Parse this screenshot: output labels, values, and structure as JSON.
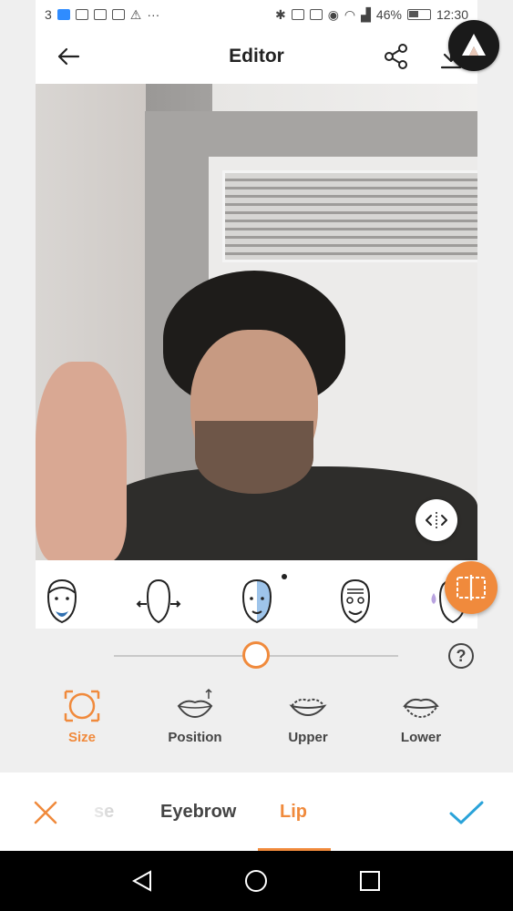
{
  "status_bar": {
    "left_text": "3",
    "dots": "···",
    "battery_percent": "46%",
    "time": "12:30"
  },
  "app_bar": {
    "title": "Editor"
  },
  "tools": [
    {
      "label": "Size",
      "active": true
    },
    {
      "label": "Position",
      "active": false
    },
    {
      "label": "Upper",
      "active": false
    },
    {
      "label": "Lower",
      "active": false
    }
  ],
  "slider": {
    "value": 0.5
  },
  "help": {
    "label": "?"
  },
  "tabs": [
    {
      "label": "se",
      "faded": true
    },
    {
      "label": "Eyebrow",
      "faded": false
    },
    {
      "label": "Lip",
      "active": true
    }
  ],
  "colors": {
    "accent": "#f08a3c",
    "confirm": "#2aa3d9"
  }
}
